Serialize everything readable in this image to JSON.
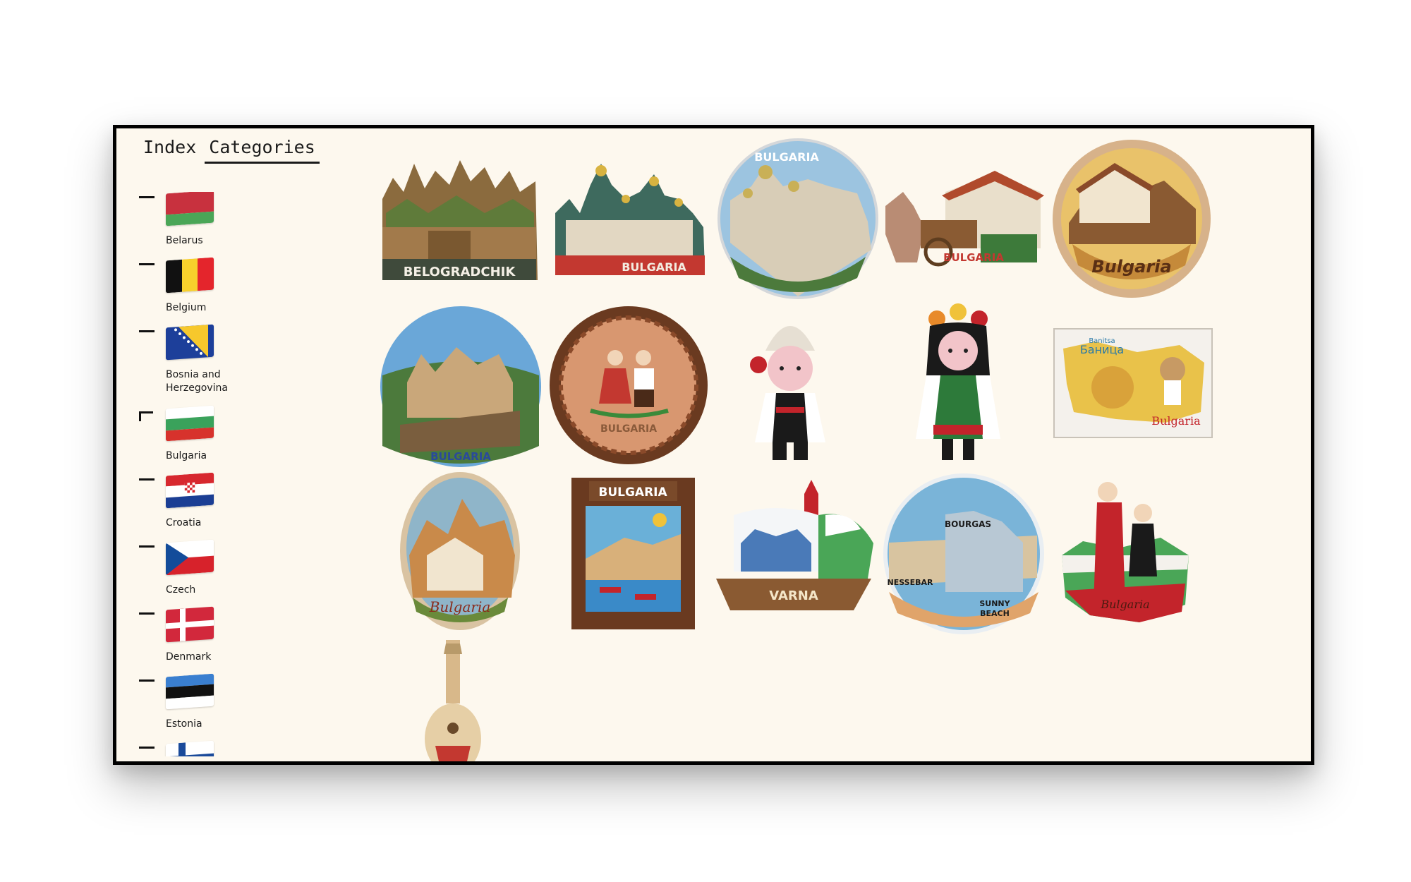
{
  "nav": {
    "tabs": [
      {
        "label": "Index"
      },
      {
        "label": "Categories"
      }
    ]
  },
  "sidebar": {
    "countries": [
      {
        "label": "Belarus"
      },
      {
        "label": "Belgium"
      },
      {
        "label": "Bosnia and Herzegovina"
      },
      {
        "label": "Bulgaria"
      },
      {
        "label": "Croatia"
      },
      {
        "label": "Czech"
      },
      {
        "label": "Denmark"
      },
      {
        "label": "Estonia"
      }
    ]
  },
  "magnets": [
    {
      "caption": "BELOGRADCHIK"
    },
    {
      "caption": "BULGARIA"
    },
    {
      "caption": "BULGARIA"
    },
    {
      "caption": "BULGARIA"
    },
    {
      "caption": "Bulgaria"
    },
    {
      "caption": "BULGARIA"
    },
    {
      "caption": "BULGARIA"
    },
    {
      "caption": ""
    },
    {
      "caption": ""
    },
    {
      "caption": "Bulgaria",
      "title": "Баница",
      "subtitle": "Banitsa"
    },
    {
      "caption": "Bulgaria"
    },
    {
      "caption": "BULGARIA"
    },
    {
      "caption": "VARNA"
    },
    {
      "caption": "BOURGAS",
      "extra1": "NESSEBAR",
      "extra2": "SUNNY",
      "extra3": "BEACH"
    },
    {
      "caption": "Bulgaria"
    },
    {
      "caption": ""
    }
  ],
  "colors": {
    "background": "#fdf8ee",
    "frame": "#000000"
  }
}
